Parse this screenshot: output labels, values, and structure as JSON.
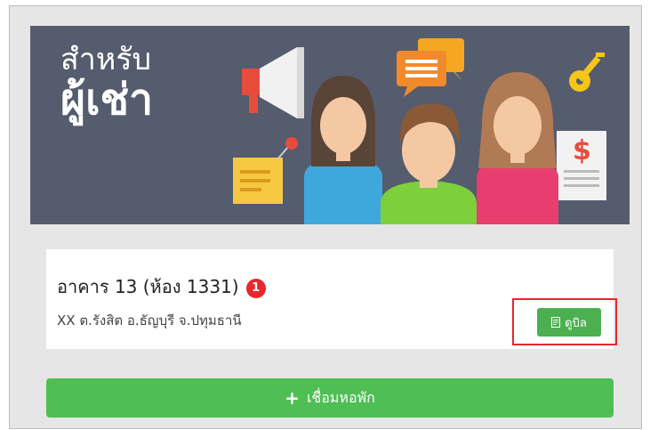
{
  "banner": {
    "title_line1": "สำหรับ",
    "title_line2": "ผู้เช่า",
    "illustration_icons": [
      "megaphone-icon",
      "chat-bubbles-icon",
      "key-icon",
      "note-pin-icon",
      "invoice-dollar-icon"
    ],
    "dollar_sign": "$"
  },
  "property_card": {
    "building_name": "อาคาร 13 (ห้อง 1331)",
    "notification_count": "1",
    "address": "XX ต.รังสิต อ.ธัญบุรี จ.ปทุมธานี",
    "view_button_label": "ดูบิล"
  },
  "connect_button": {
    "icon": "+",
    "label": "เชื่อมหอพัก"
  },
  "colors": {
    "banner_bg": "#555c6e",
    "button_green": "#4caf50",
    "badge_red": "#e8262d",
    "highlight_red": "#e8262d"
  }
}
